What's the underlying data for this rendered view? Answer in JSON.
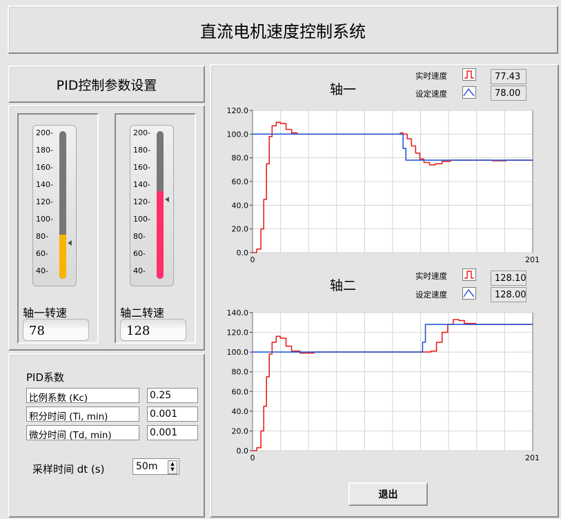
{
  "window": {
    "title": "直流电机速度控制系统"
  },
  "pid_header": "PID控制参数设置",
  "tanks": [
    {
      "label": "轴一转速",
      "value": "78",
      "level": 78,
      "ticks": [
        "200-",
        "180-",
        "160-",
        "140-",
        "120-",
        "100-",
        "80-",
        "60-",
        "40-"
      ],
      "fill_color": "#f7b500"
    },
    {
      "label": "轴二转速",
      "value": "128",
      "level": 128,
      "ticks": [
        "200-",
        "180-",
        "160-",
        "140-",
        "120-",
        "100-",
        "80-",
        "60-",
        "40-"
      ],
      "fill_color": "#ff2e6b"
    }
  ],
  "coef": {
    "title": "PID系数",
    "rows": [
      {
        "label": "比例系数 (Kc)",
        "value": "0.25"
      },
      {
        "label": "积分时间 (Ti, min)",
        "value": "0.001"
      },
      {
        "label": "微分时间 (Td, min)",
        "value": "0.001"
      }
    ],
    "dt_label": "采样时间 dt (s)",
    "dt_value": "50m"
  },
  "charts": [
    {
      "title": "轴一",
      "legend": [
        {
          "name": "实时速度",
          "value": "77.43",
          "icon": "square-wave-icon"
        },
        {
          "name": "设定速度",
          "value": "78.00",
          "icon": "triangle-wave-icon"
        }
      ]
    },
    {
      "title": "轴二",
      "legend": [
        {
          "name": "实时速度",
          "value": "128.10",
          "icon": "square-wave-icon"
        },
        {
          "name": "设定速度",
          "value": "128.00",
          "icon": "triangle-wave-icon"
        }
      ]
    }
  ],
  "chart_data": [
    {
      "type": "line",
      "title": "轴一",
      "xlim": [
        0,
        201
      ],
      "ylim": [
        0,
        120
      ],
      "x_ticks": [
        "0",
        "201"
      ],
      "y_ticks": [
        "0.0",
        "20.0",
        "40.0",
        "60.0",
        "80.0",
        "100.0",
        "120.0"
      ],
      "grid": true,
      "series": [
        {
          "name": "实时速度",
          "color": "#e8211f",
          "points": [
            [
              0,
              0
            ],
            [
              3,
              3
            ],
            [
              6,
              20
            ],
            [
              8,
              45
            ],
            [
              10,
              75
            ],
            [
              12,
              98
            ],
            [
              14,
              107
            ],
            [
              17,
              110
            ],
            [
              20,
              109
            ],
            [
              24,
              104
            ],
            [
              28,
              101
            ],
            [
              32,
              100
            ],
            [
              40,
              100
            ],
            [
              50,
              100
            ],
            [
              60,
              100
            ],
            [
              72,
              100
            ],
            [
              82,
              100
            ],
            [
              94,
              100
            ],
            [
              102,
              100
            ],
            [
              106,
              101
            ],
            [
              108,
              100
            ],
            [
              111,
              96
            ],
            [
              114,
              90
            ],
            [
              117,
              84
            ],
            [
              120,
              79
            ],
            [
              123,
              76
            ],
            [
              127,
              74
            ],
            [
              131,
              75
            ],
            [
              136,
              77
            ],
            [
              142,
              78
            ],
            [
              150,
              78
            ],
            [
              160,
              78
            ],
            [
              172,
              77.5
            ],
            [
              182,
              78
            ],
            [
              194,
              78
            ],
            [
              204,
              77.5
            ],
            [
              213,
              77.5
            ]
          ]
        },
        {
          "name": "设定速度",
          "color": "#2458d4",
          "points": [
            [
              0,
              100
            ],
            [
              100,
              100
            ],
            [
              104,
              100
            ],
            [
              108,
              88
            ],
            [
              110,
              78
            ],
            [
              213,
              78
            ]
          ]
        }
      ]
    },
    {
      "type": "line",
      "title": "轴二",
      "xlim": [
        0,
        201
      ],
      "ylim": [
        0,
        140
      ],
      "x_ticks": [
        "0",
        "201"
      ],
      "y_ticks": [
        "0.0",
        "20.0",
        "40.0",
        "60.0",
        "80.0",
        "100.0",
        "120.0",
        "140.0"
      ],
      "grid": true,
      "series": [
        {
          "name": "实时速度",
          "color": "#e8211f",
          "points": [
            [
              0,
              0
            ],
            [
              3,
              3
            ],
            [
              6,
              20
            ],
            [
              8,
              45
            ],
            [
              10,
              75
            ],
            [
              12,
              98
            ],
            [
              14,
              110
            ],
            [
              17,
              116
            ],
            [
              20,
              114
            ],
            [
              24,
              106
            ],
            [
              28,
              101
            ],
            [
              34,
              99
            ],
            [
              44,
              100
            ],
            [
              60,
              100
            ],
            [
              76,
              100
            ],
            [
              92,
              100
            ],
            [
              110,
              100
            ],
            [
              122,
              100
            ],
            [
              128,
              101
            ],
            [
              132,
              110
            ],
            [
              136,
              120
            ],
            [
              140,
              128
            ],
            [
              144,
              133
            ],
            [
              148,
              132
            ],
            [
              152,
              129
            ],
            [
              160,
              128
            ],
            [
              172,
              128
            ],
            [
              184,
              128
            ],
            [
              196,
              128
            ],
            [
              206,
              128
            ],
            [
              213,
              128
            ]
          ]
        },
        {
          "name": "设定速度",
          "color": "#2458d4",
          "points": [
            [
              0,
              100
            ],
            [
              118,
              100
            ],
            [
              122,
              110
            ],
            [
              124,
              128
            ],
            [
              213,
              128
            ]
          ]
        }
      ]
    }
  ],
  "exit_button": "退出"
}
